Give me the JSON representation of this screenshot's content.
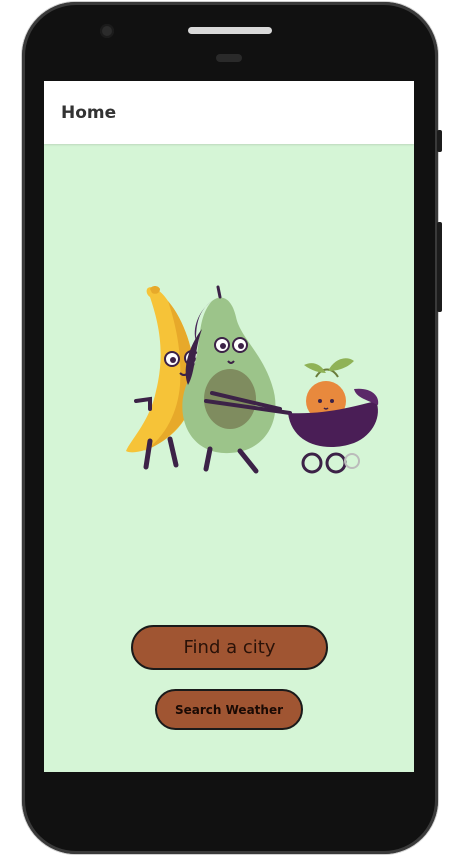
{
  "appbar": {
    "title": "Home"
  },
  "main": {
    "illustration": "banana-and-avocado-pushing-stroller",
    "find_city_label": "Find a city",
    "search_weather_label": "Search Weather"
  },
  "colors": {
    "background": "#d5f5d6",
    "button": "#a05532",
    "appbar": "#ffffff"
  }
}
